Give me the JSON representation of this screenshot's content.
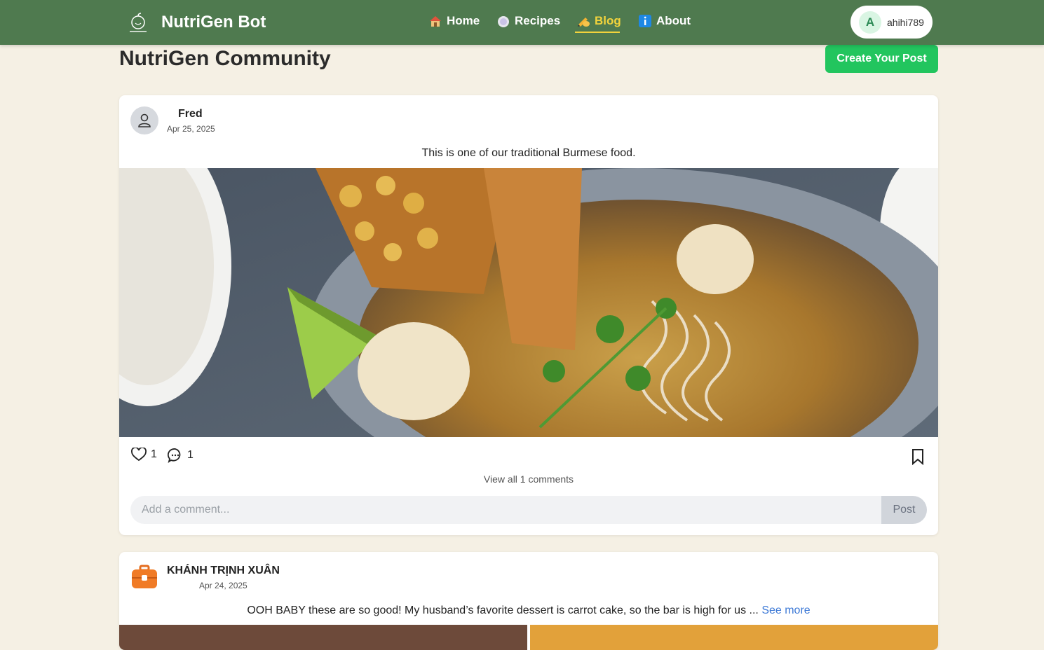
{
  "header": {
    "brand": "NutriGen Bot",
    "nav": [
      {
        "label": "Home",
        "icon": "house-icon"
      },
      {
        "label": "Recipes",
        "icon": "plate-icon"
      },
      {
        "label": "Blog",
        "icon": "writing-hand-icon",
        "active": true
      },
      {
        "label": "About",
        "icon": "info-icon"
      }
    ],
    "user": {
      "initial": "A",
      "name": "ahihi789"
    }
  },
  "page": {
    "title": "NutriGen Community",
    "create_button": "Create Your Post"
  },
  "posts": [
    {
      "author": "Fred",
      "date": "Apr 25, 2025",
      "caption": "This is one of our traditional Burmese food.",
      "likes": "1",
      "comments": "1",
      "view_all": "View all 1 comments",
      "comment_placeholder": "Add a comment...",
      "post_button": "Post",
      "image": "mohinga-noodle-soup-photo"
    },
    {
      "author": "KHÁNH TRỊNH XUÂN",
      "date": "Apr 24, 2025",
      "caption": "OOH BABY these are so good! My husband’s favorite dessert is carrot cake, so the bar is high for us ...",
      "see_more": "See more",
      "avatar": "briefcase-icon"
    }
  ],
  "colors": {
    "header_bg": "#4f7a4f",
    "page_bg": "#f5f0e4",
    "accent_green": "#22c55e",
    "active_nav": "#f2d33c",
    "link_blue": "#3b78d6"
  }
}
